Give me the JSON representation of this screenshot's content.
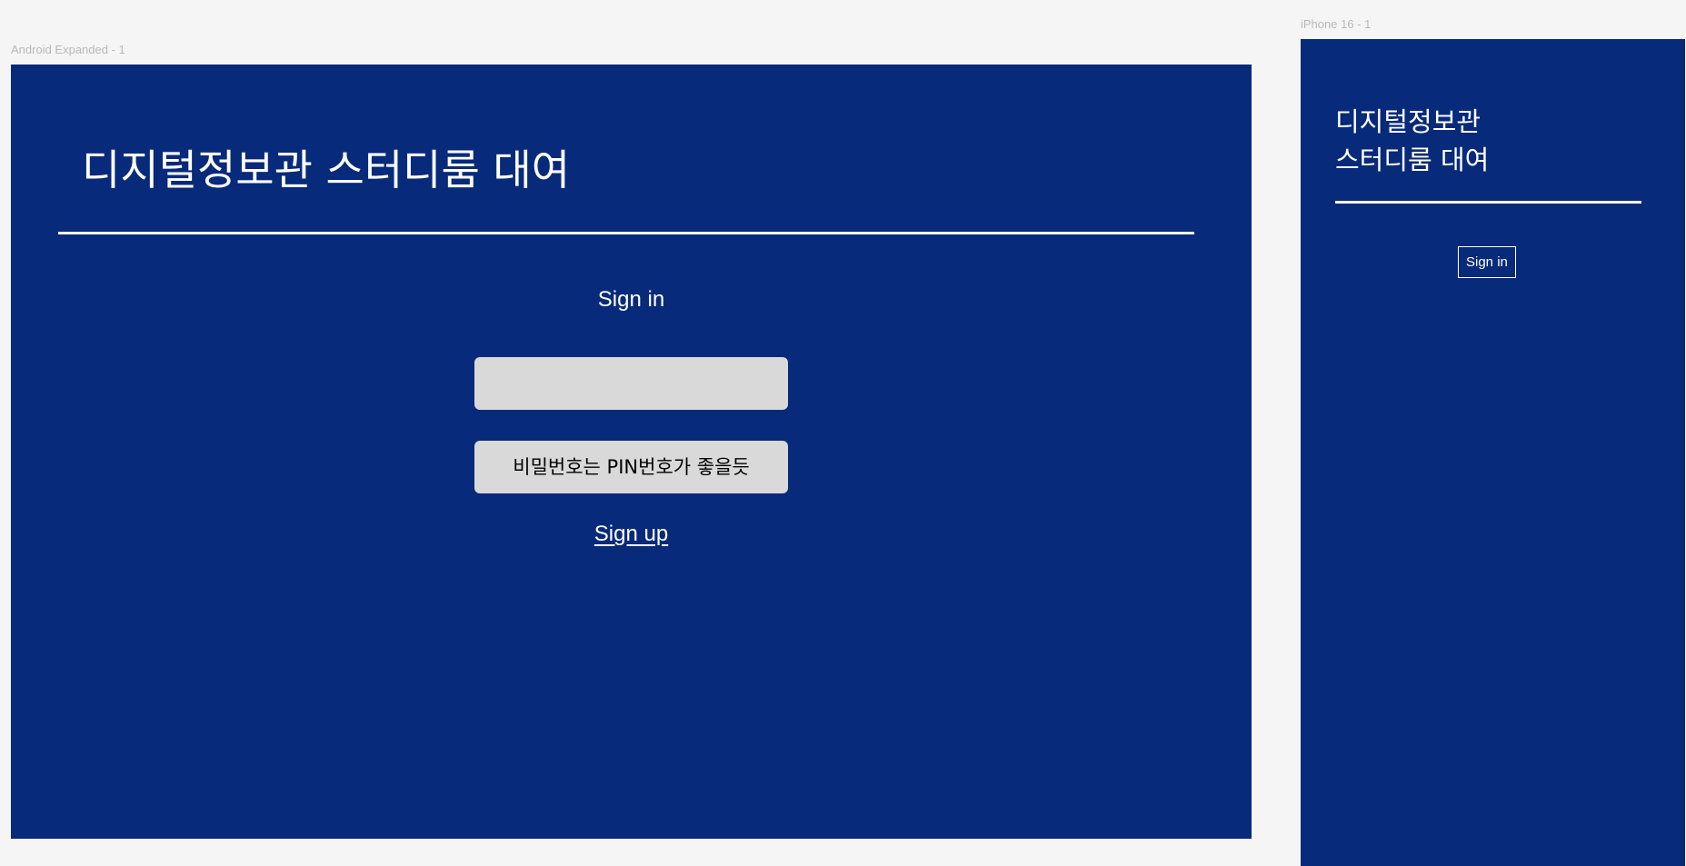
{
  "canvas": {
    "background": "#f5f5f5"
  },
  "android_frame": {
    "label": "Android Expanded - 1",
    "background": "#082a7a",
    "title": "디지털정보관 스터디룸 대여",
    "signin_heading": "Sign in",
    "id_input": {
      "value": "",
      "placeholder": ""
    },
    "password_input": {
      "value": "",
      "placeholder": "비밀번호는 PIN번호가 좋을듯"
    },
    "signup_link": "Sign up"
  },
  "iphone_frame": {
    "label": "iPhone 16 - 1",
    "background": "#082a7a",
    "title": "디지털정보관\n스터디룸 대여",
    "signin_button": "Sign in"
  }
}
